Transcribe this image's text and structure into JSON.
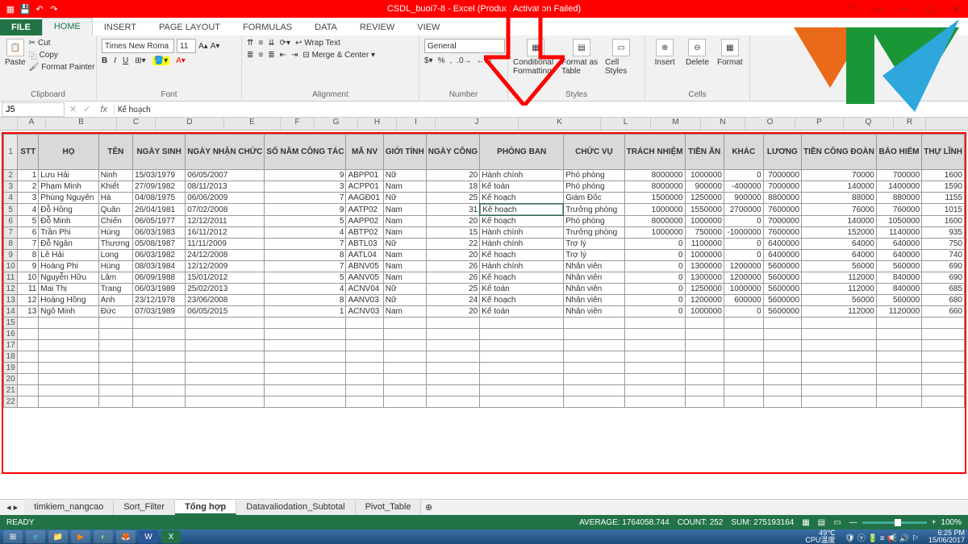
{
  "title": "CSDL_buoi7-8 - Excel (Product Activation Failed)",
  "qat": {
    "save": "💾",
    "undo": "↶",
    "redo": "↷"
  },
  "tabs": [
    "FILE",
    "HOME",
    "INSERT",
    "PAGE LAYOUT",
    "FORMULAS",
    "DATA",
    "REVIEW",
    "VIEW"
  ],
  "active_tab": "HOME",
  "ribbon": {
    "clipboard": {
      "label": "Clipboard",
      "paste": "Paste",
      "cut": "Cut",
      "copy": "Copy",
      "fp": "Format Painter"
    },
    "font": {
      "label": "Font",
      "name": "Times New Roma",
      "size": "11"
    },
    "alignment": {
      "label": "Alignment",
      "wrap": "Wrap Text",
      "merge": "Merge & Center"
    },
    "number": {
      "label": "Number",
      "format": "General"
    },
    "styles": {
      "label": "Styles",
      "cf": "Conditional Formatting",
      "fat": "Format as Table",
      "cs": "Cell Styles"
    },
    "cells": {
      "label": "Cells",
      "insert": "Insert",
      "delete": "Delete",
      "format": "Format"
    }
  },
  "namebox": "J5",
  "formula": "Kế hoạch",
  "columns": [
    "A",
    "B",
    "C",
    "D",
    "E",
    "F",
    "G",
    "H",
    "I",
    "J",
    "K",
    "L",
    "M",
    "N",
    "O",
    "P",
    "Q",
    "R"
  ],
  "headers": [
    "STT",
    "HỌ",
    "TÊN",
    "NGÀY SINH",
    "NGÀY NHẬN CHỨC",
    "SỐ NĂM CÔNG TÁC",
    "MÃ NV",
    "GIỚI TÍNH",
    "NGÀY CÔNG",
    "PHÒNG BAN",
    "CHỨC VỤ",
    "TRÁCH NHIỆM",
    "TIỀN ĂN",
    "KHÁC",
    "LƯƠNG",
    "TIỀN CÔNG ĐOÀN",
    "BẢO HIỂM",
    "THỰ LĨNH"
  ],
  "rows": [
    [
      "1",
      "Lưu Hải",
      "Ninh",
      "15/03/1979",
      "06/05/2007",
      "9",
      "ABPP01",
      "Nữ",
      "20",
      "Hành chính",
      "Phó phòng",
      "8000000",
      "1000000",
      "0",
      "7000000",
      "70000",
      "700000",
      "1600"
    ],
    [
      "2",
      "Phạm Minh",
      "Khiết",
      "27/09/1982",
      "08/11/2013",
      "3",
      "ACPP01",
      "Nam",
      "18",
      "Kế toán",
      "Phó phòng",
      "8000000",
      "900000",
      "-400000",
      "7000000",
      "140000",
      "1400000",
      "1590"
    ],
    [
      "3",
      "Phùng Nguyên",
      "Hà",
      "04/08/1975",
      "06/06/2009",
      "7",
      "AAGĐ01",
      "Nữ",
      "25",
      "Kế hoạch",
      "Giám Đốc",
      "1500000",
      "1250000",
      "900000",
      "8800000",
      "88000",
      "880000",
      "1155"
    ],
    [
      "4",
      "Đỗ Hồng",
      "Quân",
      "26/04/1981",
      "07/02/2008",
      "9",
      "AATP02",
      "Nam",
      "31",
      "Kế hoạch",
      "Trưởng phòng",
      "1000000",
      "1550000",
      "2700000",
      "7600000",
      "76000",
      "760000",
      "1015"
    ],
    [
      "5",
      "Đỗ Minh",
      "Chiến",
      "06/05/1977",
      "12/12/2011",
      "5",
      "AAPP02",
      "Nam",
      "20",
      "Kế hoạch",
      "Phó phòng",
      "8000000",
      "1000000",
      "0",
      "7000000",
      "140000",
      "1050000",
      "1600"
    ],
    [
      "6",
      "Trần Phi",
      "Hùng",
      "06/03/1983",
      "16/11/2012",
      "4",
      "ABTP02",
      "Nam",
      "15",
      "Hành chính",
      "Trưởng phòng",
      "1000000",
      "750000",
      "-1000000",
      "7600000",
      "152000",
      "1140000",
      "935"
    ],
    [
      "7",
      "Đỗ Ngân",
      "Thương",
      "05/08/1987",
      "11/11/2009",
      "7",
      "ABTL03",
      "Nữ",
      "22",
      "Hành chính",
      "Trợ lý",
      "0",
      "1100000",
      "0",
      "6400000",
      "64000",
      "640000",
      "750"
    ],
    [
      "8",
      "Lê Hải",
      "Long",
      "06/03/1982",
      "24/12/2008",
      "8",
      "AATL04",
      "Nam",
      "20",
      "Kế hoạch",
      "Trợ lý",
      "0",
      "1000000",
      "0",
      "6400000",
      "64000",
      "640000",
      "740"
    ],
    [
      "9",
      "Hoàng Phi",
      "Hùng",
      "08/03/1984",
      "12/12/2009",
      "7",
      "ABNV05",
      "Nam",
      "26",
      "Hành chính",
      "Nhân viên",
      "0",
      "1300000",
      "1200000",
      "5600000",
      "56000",
      "560000",
      "690"
    ],
    [
      "10",
      "Nguyễn Hữu",
      "Lâm",
      "06/09/1988",
      "15/01/2012",
      "5",
      "AANV05",
      "Nam",
      "26",
      "Kế hoạch",
      "Nhân viên",
      "0",
      "1300000",
      "1200000",
      "5600000",
      "112000",
      "840000",
      "690"
    ],
    [
      "11",
      "Mai Thị",
      "Trang",
      "06/03/1989",
      "25/02/2013",
      "4",
      "ACNV04",
      "Nữ",
      "25",
      "Kế toán",
      "Nhân viên",
      "0",
      "1250000",
      "1000000",
      "5600000",
      "112000",
      "840000",
      "685"
    ],
    [
      "12",
      "Hoàng Hồng",
      "Anh",
      "23/12/1978",
      "23/06/2008",
      "8",
      "AANV03",
      "Nữ",
      "24",
      "Kế hoạch",
      "Nhân viên",
      "0",
      "1200000",
      "600000",
      "5600000",
      "56000",
      "560000",
      "680"
    ],
    [
      "13",
      "Ngô Minh",
      "Đức",
      "07/03/1989",
      "06/05/2015",
      "1",
      "ACNV03",
      "Nam",
      "20",
      "Kế toán",
      "Nhân viên",
      "0",
      "1000000",
      "0",
      "5600000",
      "112000",
      "1120000",
      "660"
    ]
  ],
  "selected": {
    "row": 3,
    "col": 9
  },
  "sheets": [
    "timkiem_nangcao",
    "Sort_Filter",
    "Tổng hợp",
    "Datavaliodation_Subtotal",
    "Pivot_Table"
  ],
  "active_sheet": "Tổng hợp",
  "status": {
    "ready": "READY",
    "avg": "AVERAGE: 1764058.744",
    "count": "COUNT: 252",
    "sum": "SUM: 275193164",
    "zoom": "100%"
  },
  "taskbar": {
    "temp": "49℃",
    "cpu": "CPU温度",
    "time": "6:25 PM",
    "date": "15/06/2017"
  }
}
